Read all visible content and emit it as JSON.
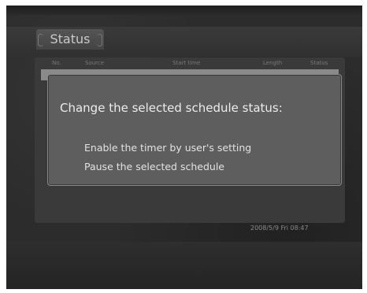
{
  "tabs": [
    {
      "label": "Status",
      "active": true
    },
    {
      "label": "",
      "active": false
    },
    {
      "label": "",
      "active": false
    },
    {
      "label": "",
      "active": false
    }
  ],
  "list": {
    "columns": [
      "No.",
      "Source",
      "Start time",
      "Length",
      "Status"
    ]
  },
  "dialog": {
    "title": "Change the selected schedule status:",
    "options": [
      "Enable the timer by user's setting",
      "Pause the selected schedule"
    ]
  },
  "datetime": "2008/5/9 Fri 08:47",
  "colors": {
    "screen_bg": "#2c2c2c",
    "dialog_bg": "#5e5e5e",
    "dialog_text": "#ececec",
    "highlight_row": "#8a8a8a"
  }
}
